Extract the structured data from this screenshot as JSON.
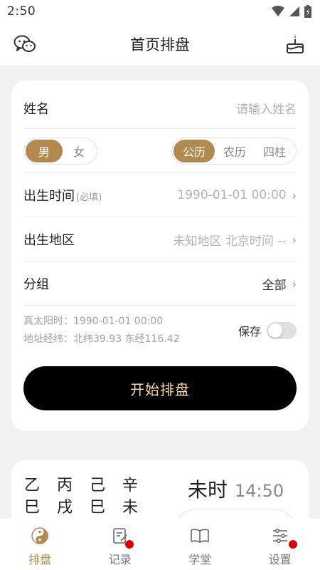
{
  "status": {
    "time": "2:50"
  },
  "header": {
    "title": "首页排盘",
    "left_icon": "wechat-icon",
    "right_icon": "cake-icon"
  },
  "form": {
    "name": {
      "label": "姓名",
      "placeholder": "请输入姓名"
    },
    "gender": {
      "options": [
        "男",
        "女"
      ],
      "selected": "男"
    },
    "calendar": {
      "options": [
        "公历",
        "农历",
        "四柱"
      ],
      "selected": "公历"
    },
    "birth_time": {
      "label": "出生时间",
      "required_note": "(必填)",
      "value": "1990-01-01 00:00"
    },
    "birth_place": {
      "label": "出生地区",
      "value": "未知地区 北京时间 --"
    },
    "group": {
      "label": "分组",
      "value": "全部"
    },
    "solar_time": "真太阳时：1990-01-01 00:00",
    "coordinates": "地址经纬：北纬39.93 东经116.42",
    "save_label": "保存",
    "save_enabled": false,
    "start_button": "开始排盘"
  },
  "today": {
    "ganzhi": [
      "乙",
      "丙",
      "己",
      "辛",
      "巳",
      "戌",
      "巳",
      "未"
    ],
    "shichen": "未时",
    "time": "14:50"
  },
  "tabbar": [
    {
      "label": "排盘",
      "icon": "yin-yang-icon",
      "active": true,
      "dot": false
    },
    {
      "label": "记录",
      "icon": "record-icon",
      "active": false,
      "dot": true
    },
    {
      "label": "学堂",
      "icon": "book-icon",
      "active": false,
      "dot": false
    },
    {
      "label": "设置",
      "icon": "settings-icon",
      "active": false,
      "dot": true
    }
  ],
  "colors": {
    "accent": "#b28a4f",
    "button_bg": "#000000",
    "button_text": "#f5d9a8",
    "badge": "#e00000"
  }
}
